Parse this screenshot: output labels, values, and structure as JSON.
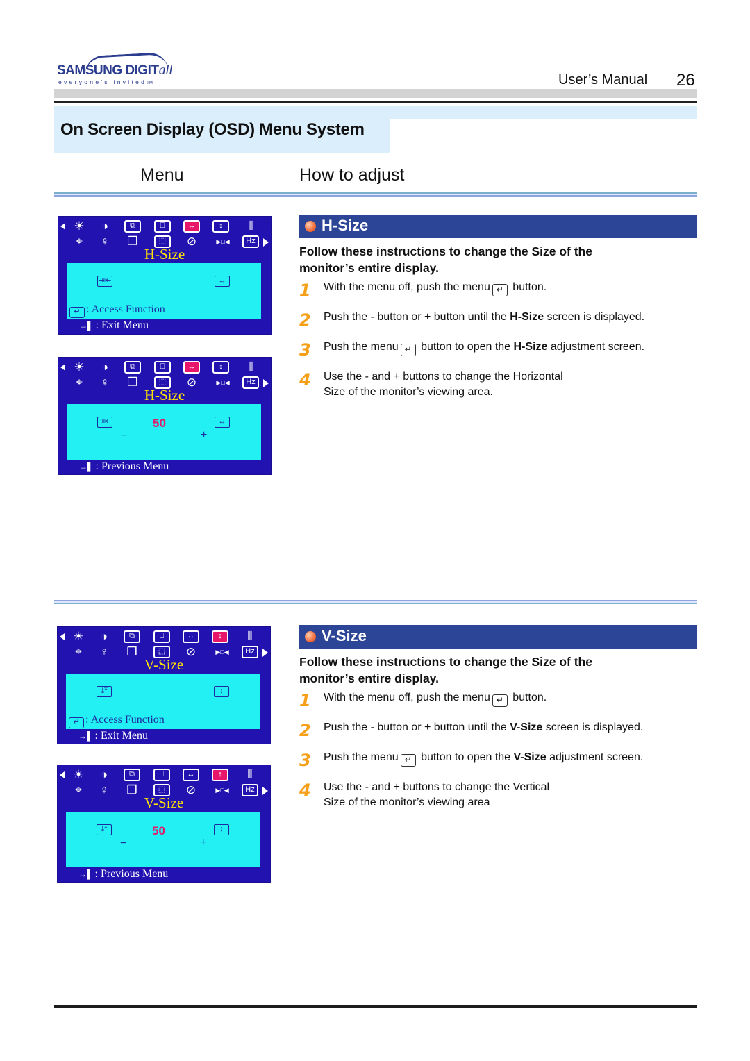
{
  "header": {
    "brand": "SAMSUNG DIGIT",
    "brand_suffix": "all",
    "tagline": "everyone's invited",
    "tm": "TM",
    "manual_label": "User’s  Manual",
    "page_number": "26"
  },
  "section_title": "On Screen Display (OSD) Menu System",
  "columns": {
    "menu": "Menu",
    "adjust": "How to adjust"
  },
  "osd_icons_row1": [
    "brightness-icon",
    "contrast-icon",
    "h-position-icon",
    "v-position-icon",
    "h-size-icon",
    "v-size-icon",
    "pincushion-icon"
  ],
  "osd_icons_row2": [
    "rotation-icon",
    "language-icon",
    "recall-icon",
    "degauss-icon",
    "moire-icon",
    "trapezoid-icon",
    "hz-icon"
  ],
  "osd_glyphs_row1": [
    "☀",
    "◑",
    "⧉",
    "⎕",
    "↔",
    "↕",
    "⫴"
  ],
  "osd_glyphs_row2": [
    "⌖",
    "♀",
    "❐",
    "⬚",
    "⊘",
    "▶□◀",
    "Hz"
  ],
  "sections": [
    {
      "id": "h-size",
      "heading": "H-Size",
      "osd_title": "H-Size",
      "selected_icon_index": 4,
      "lead": "Follow these instructions to change the  Size of the monitor’s entire display.",
      "menu1": {
        "shrink_glyph": "⇥⇤",
        "expand_glyph": "↔",
        "access": ": Access Function",
        "exit": ": Exit Menu"
      },
      "menu2": {
        "shrink_glyph": "⇥⇤",
        "expand_glyph": "↔",
        "value": "50",
        "minus": "−",
        "plus": "+",
        "previous": ":  Previous Menu"
      },
      "steps": [
        {
          "num": "1",
          "pre": "With the menu off, push the menu",
          "post": " button."
        },
        {
          "num": "2",
          "pre": "Push the  - button or  + button until the ",
          "bold": "H-Size",
          "post": "  screen is displayed."
        },
        {
          "num": "3",
          "pre": "Push the menu",
          "mid": " button to open the ",
          "bold": "H-Size",
          "post": " adjustment screen."
        },
        {
          "num": "4",
          "line1": "Use the  - and  + buttons to change the Horizontal",
          "line2": "Size of the monitor’s viewing area."
        }
      ]
    },
    {
      "id": "v-size",
      "heading": "V-Size",
      "osd_title": "V-Size",
      "selected_icon_index": 5,
      "lead": "Follow these instructions to change the  Size of the monitor’s entire display.",
      "menu1": {
        "shrink_glyph": "⤓⤒",
        "expand_glyph": "↕",
        "access": ": Access Function",
        "exit": ": Exit Menu"
      },
      "menu2": {
        "shrink_glyph": "⤓⤒",
        "expand_glyph": "↕",
        "value": "50",
        "minus": "−",
        "plus": "+",
        "previous": ":  Previous Menu"
      },
      "steps": [
        {
          "num": "1",
          "pre": "With the menu off, push the menu",
          "post": " button."
        },
        {
          "num": "2",
          "pre": "Push the  - button or  + button until the ",
          "bold": "V-Size",
          "post": " screen is displayed."
        },
        {
          "num": "3",
          "pre": "Push the menu",
          "mid": " button to open the ",
          "bold": "V-Size",
          "post": " adjustment screen."
        },
        {
          "num": "4",
          "line1": "Use the  - and  + buttons to change the Vertical",
          "line2": "Size of the monitor’s viewing area"
        }
      ]
    }
  ],
  "glyphs": {
    "enter": "↵",
    "door": "→▌"
  },
  "colors": {
    "osd_bg": "#2213b0",
    "osd_screen": "#22f0f2",
    "osd_title": "#ffe400",
    "osd_selected": "#e8166a",
    "section_header": "#2c4597",
    "step_number": "#f6a019",
    "title_band": "#dbeefb"
  }
}
